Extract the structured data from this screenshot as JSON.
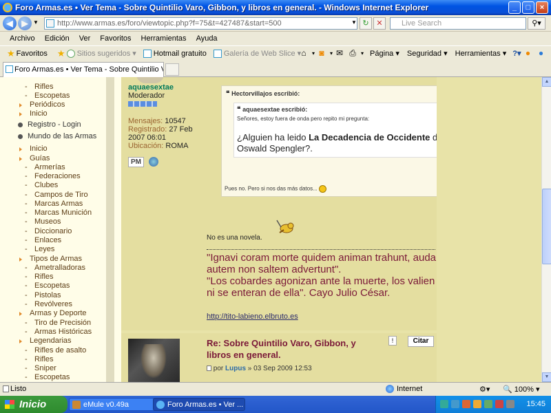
{
  "window": {
    "title": "Foro Armas.es • Ver Tema - Sobre Quintilio Varo, Gibbon, y libros en general. - Windows Internet Explorer",
    "minimize": "_",
    "maximize": "□",
    "close": "×"
  },
  "address": {
    "url": "http://www.armas.es/foro/viewtopic.php?f=75&t=427487&start=500",
    "search_placeholder": "Live Search"
  },
  "menu": [
    "Archivo",
    "Edición",
    "Ver",
    "Favoritos",
    "Herramientas",
    "Ayuda"
  ],
  "favorites_bar": {
    "favorites": "Favoritos",
    "suggested": "Sitios sugeridos ▾",
    "hotmail": "Hotmail gratuito",
    "webslice": "Galería de Web Slice ▾",
    "page": "Página ▾",
    "security": "Seguridad ▾",
    "tools": "Herramientas ▾",
    "help": "?▾"
  },
  "tab": {
    "title": "Foro Armas.es • Ver Tema - Sobre Quintilio Varo, Gibb..."
  },
  "sidebar": {
    "items": [
      {
        "label": "Rifles",
        "type": "l2"
      },
      {
        "label": "Escopetas",
        "type": "l2"
      },
      {
        "label": "Periódicos",
        "type": "l1"
      },
      {
        "label": "Inicio",
        "type": "l1"
      },
      {
        "label": "Registro - Login",
        "type": "sec"
      },
      {
        "label": "Mundo de las Armas",
        "type": "sec"
      },
      {
        "label": "Inicio",
        "type": "l1"
      },
      {
        "label": "Guías",
        "type": "l1"
      },
      {
        "label": "Armerías",
        "type": "l2"
      },
      {
        "label": "Federaciones",
        "type": "l2"
      },
      {
        "label": "Clubes",
        "type": "l2"
      },
      {
        "label": "Campos de Tiro",
        "type": "l2"
      },
      {
        "label": "Marcas Armas",
        "type": "l2"
      },
      {
        "label": "Marcas Munición",
        "type": "l2"
      },
      {
        "label": "Museos",
        "type": "l2"
      },
      {
        "label": "Diccionario",
        "type": "l2"
      },
      {
        "label": "Enlaces",
        "type": "l2"
      },
      {
        "label": "Leyes",
        "type": "l2"
      },
      {
        "label": "Tipos de Armas",
        "type": "l1"
      },
      {
        "label": "Ametralladoras",
        "type": "l2"
      },
      {
        "label": "Rifles",
        "type": "l2"
      },
      {
        "label": "Escopetas",
        "type": "l2"
      },
      {
        "label": "Pistolas",
        "type": "l2"
      },
      {
        "label": "Revólveres",
        "type": "l2"
      },
      {
        "label": "Armas y Deporte",
        "type": "l1"
      },
      {
        "label": "Tiro de Precisión",
        "type": "l2"
      },
      {
        "label": "Armas Históricas",
        "type": "l2"
      },
      {
        "label": "Legendarias",
        "type": "l1"
      },
      {
        "label": "Rifles de asalto",
        "type": "l2"
      },
      {
        "label": "Rifles",
        "type": "l2"
      },
      {
        "label": "Sniper",
        "type": "l2"
      },
      {
        "label": "Escopetas",
        "type": "l2"
      }
    ]
  },
  "post1": {
    "author": "aquaesextae",
    "role": "Moderador",
    "messages_label": "Mensajes:",
    "messages": "10547",
    "registered_label": "Registrado:",
    "registered": "27 Feb 2007 06:01",
    "location_label": "Ubicación:",
    "location": "ROMA",
    "pm": "PM",
    "outer_quote_header": "Hectorvillajos escribió:",
    "inner_quote_header": "aquaesextae escribió:",
    "inner_small": "Señores, estoy fuera de onda pero repito mi pregunta:",
    "inner_big_pre": "¿Alguien ha leido ",
    "inner_big_bold": "La Decadencia de Occidente",
    "inner_big_post": " de",
    "inner_big_line2": "Oswald Spengler?.",
    "outer_reply": "Pues no. Pero si nos das más datos...",
    "body": "No es una novela.",
    "sig_line1": "\"Ignavi coram morte quidem animan trahunt, auda",
    "sig_line2": "autem non saltem advertunt\".",
    "sig_line3": "\"Los cobardes agonizan ante la muerte, los valien",
    "sig_line4": "ni se enteran de ella\". Cayo Julio César.",
    "sig_link": "http://tito-labieno.elbruto.es"
  },
  "post2": {
    "title": "Re: Sobre Quintilio Varo, Gibbon, y libros en general.",
    "by": "por",
    "author": "Lupus",
    "date": "» 03 Sep 2009 12:53",
    "report": "!",
    "quote_btn": "Citar"
  },
  "status": {
    "text": "Listo",
    "zone": "Internet",
    "zoom": "100%"
  },
  "taskbar": {
    "start": "Inicio",
    "tasks": [
      "eMule v0.49a",
      "Foro Armas.es • Ver ..."
    ],
    "clock": "15:45"
  }
}
